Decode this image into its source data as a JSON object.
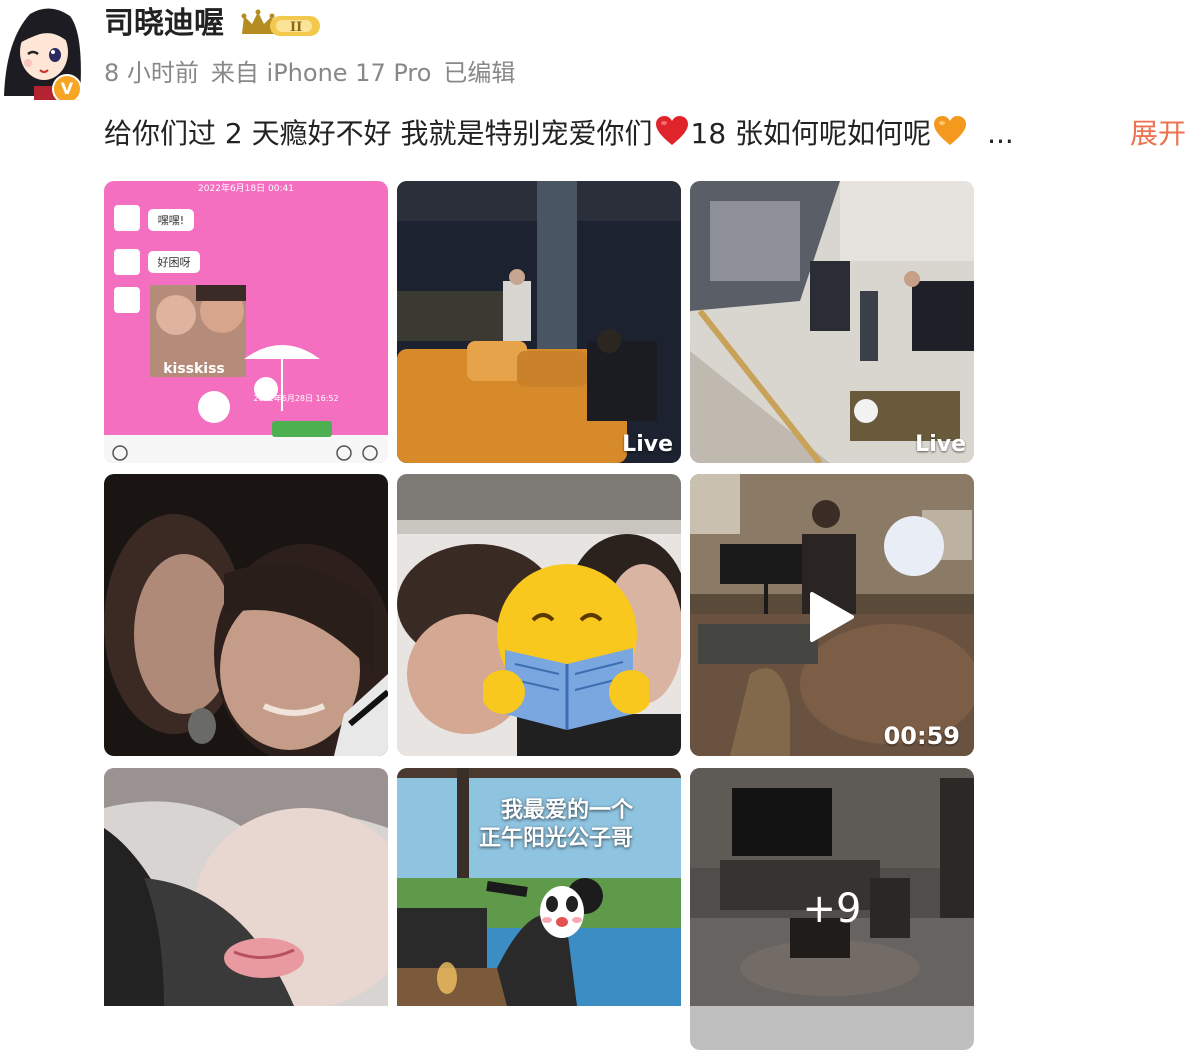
{
  "post": {
    "author": {
      "name": "司晓迪喔",
      "level_badge": "II"
    },
    "meta": {
      "time": "8 小时前",
      "source": "来自 iPhone 17 Pro",
      "edited": "已编辑"
    },
    "content": {
      "part1": "给你们过 2 天瘾好不好 我就是特别宠爱你们",
      "part2": "18 张如何呢如何呢",
      "ellipsis": "...",
      "expand_label": "展开"
    },
    "images": [
      {
        "name": "chat-screenshot",
        "badge": "",
        "chat_stamp_top": "2022年6月18日 00:41",
        "chat_label_1": "嘿嘿!",
        "chat_label_2": "好困呀",
        "sticker_text": "kisskiss",
        "chat_stamp_bottom": "2022年6月28日 16:52"
      },
      {
        "name": "lounge-photo",
        "badge": "Live"
      },
      {
        "name": "living-room-photo",
        "badge": "Live"
      },
      {
        "name": "selfie-photo",
        "badge": ""
      },
      {
        "name": "bed-photo-emoji-covered",
        "badge": ""
      },
      {
        "name": "music-room-video",
        "badge": "00:59"
      },
      {
        "name": "closeup-photo",
        "badge": ""
      },
      {
        "name": "pool-photo",
        "badge": "",
        "overlay_line1": "我最爱的一个",
        "overlay_line2": "正午阳光公子哥"
      },
      {
        "name": "tv-room-photo",
        "badge": "",
        "more_count": "+9"
      }
    ]
  },
  "colors": {
    "expand": "#eb7350",
    "meta": "#888888",
    "heart_red": "#e0242c",
    "heart_orange": "#f39a1e",
    "vip_badge": "#f6a623"
  }
}
